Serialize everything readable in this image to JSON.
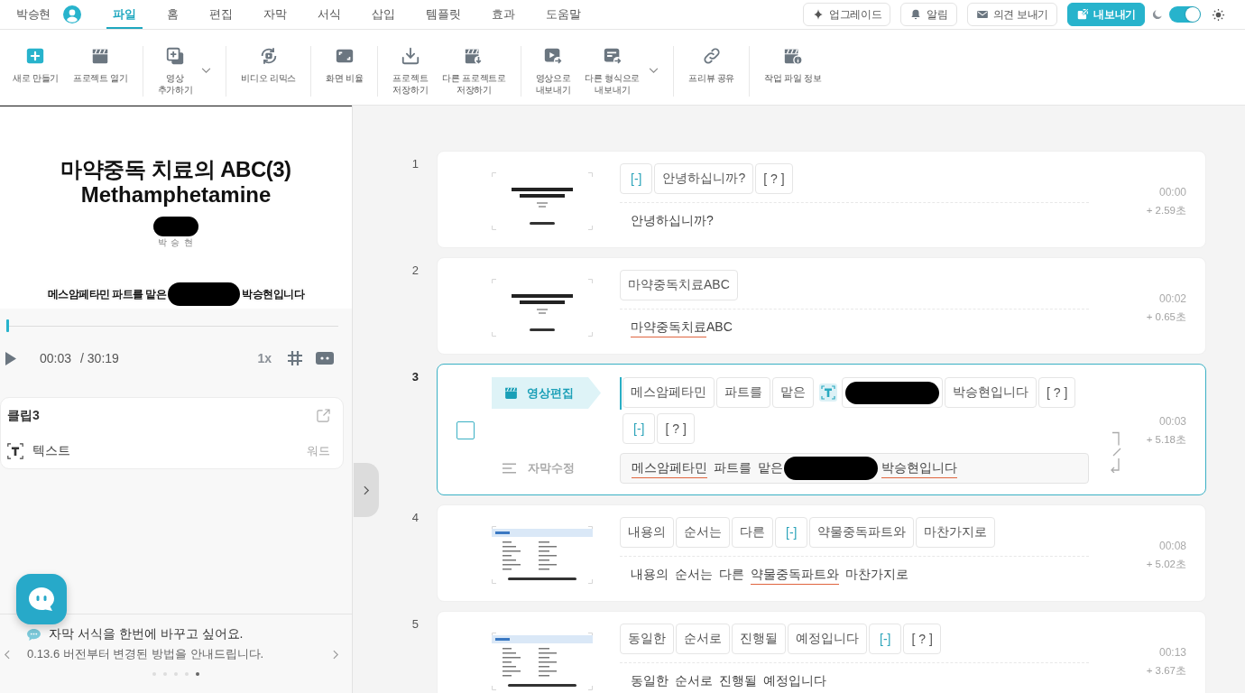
{
  "header": {
    "user": "박승현",
    "tabs": [
      {
        "label": "파일",
        "selected": true
      },
      {
        "label": "홈",
        "selected": false
      },
      {
        "label": "편집",
        "selected": false
      },
      {
        "label": "자막",
        "selected": false
      },
      {
        "label": "서식",
        "selected": false
      },
      {
        "label": "삽입",
        "selected": false
      },
      {
        "label": "템플릿",
        "selected": false
      },
      {
        "label": "효과",
        "selected": false
      },
      {
        "label": "도움말",
        "selected": false
      }
    ],
    "actions": [
      {
        "label": "업그레이드",
        "kind": "outline"
      },
      {
        "label": "알림",
        "kind": "outline"
      },
      {
        "label": "의견 보내기",
        "kind": "outline"
      },
      {
        "label": "내보내기",
        "kind": "primary"
      }
    ],
    "theme_toggle": {
      "on": true
    }
  },
  "toolbar": {
    "groups": [
      [
        {
          "label": "새로 만들기",
          "dropdown": false
        },
        {
          "label": "프로젝트 열기",
          "dropdown": false
        }
      ],
      [
        {
          "label": "영상\n추가하기",
          "dropdown": true
        }
      ],
      [
        {
          "label": "비디오 리믹스",
          "dropdown": false
        }
      ],
      [
        {
          "label": "화면 비율",
          "dropdown": false
        }
      ],
      [
        {
          "label": "프로젝트\n저장하기",
          "dropdown": false
        },
        {
          "label": "다른 프로젝트로\n저장하기",
          "dropdown": false
        }
      ],
      [
        {
          "label": "영상으로\n내보내기",
          "dropdown": false
        },
        {
          "label": "다른 형식으로\n내보내기",
          "dropdown": true
        }
      ],
      [
        {
          "label": "프리뷰 공유",
          "dropdown": false
        }
      ],
      [
        {
          "label": "작업 파일 정보",
          "dropdown": false
        }
      ]
    ]
  },
  "preview": {
    "lines": [
      {
        "kind": "title",
        "text": "마약중독 치료의 ABC(3)"
      },
      {
        "kind": "subtitle",
        "text": "Methamphetamine"
      },
      {
        "kind": "redacted"
      },
      {
        "kind": "presenter",
        "text": "박 승 현"
      }
    ],
    "caption": [
      {
        "kind": "text",
        "text": "메스암페타민 파트를 맡은"
      },
      {
        "kind": "redacted"
      },
      {
        "kind": "text",
        "text": "박승현입니다"
      }
    ]
  },
  "player": {
    "level": 0.002,
    "current": "00:03",
    "total": "/ 30:19",
    "speed": "1x"
  },
  "clip": {
    "title": "클립3",
    "type": "텍스트",
    "detail": "워드"
  },
  "tip": {
    "title": "자막 서식을 한번에 바꾸고 싶어요.",
    "body": "0.13.6 버전부터 변경된 방법을 안내드립니다.",
    "pages": [
      {
        "selected": false
      },
      {
        "selected": false
      },
      {
        "selected": false
      },
      {
        "selected": false
      },
      {
        "selected": true
      }
    ]
  },
  "rows": [
    {
      "number": "1",
      "selected": false,
      "thumbnail": {
        "kind": "title"
      },
      "chips": [
        {
          "kind": "gap",
          "text": "[-]"
        },
        {
          "kind": "word",
          "text": "안녕하십니까?"
        },
        {
          "kind": "unknown",
          "text": "[ ? ]"
        }
      ],
      "subtitle": [
        {
          "kind": "text",
          "text": "안녕하십니까?",
          "flagged": false
        }
      ],
      "time": "00:00",
      "duration": "+ 2.59초"
    },
    {
      "number": "2",
      "selected": false,
      "thumbnail": {
        "kind": "title"
      },
      "chips": [
        {
          "kind": "word",
          "text": "마약중독치료ABC"
        }
      ],
      "subtitle": [
        {
          "kind": "text",
          "text": "마약중독치료",
          "flagged": true
        },
        {
          "kind": "text",
          "text": "ABC",
          "flagged": false
        }
      ],
      "time": "00:02",
      "duration": "+ 0.65초"
    },
    {
      "number": "3",
      "selected": true,
      "editor": {
        "video_label": "영상편집",
        "subtitle_label": "자막수정",
        "checked": false
      },
      "chips": [
        {
          "kind": "word",
          "text": "메스암페타민"
        },
        {
          "kind": "word",
          "text": "파트를"
        },
        {
          "kind": "word",
          "text": "맡은"
        },
        {
          "kind": "text-clip"
        },
        {
          "kind": "redacted"
        },
        {
          "kind": "word",
          "text": "박승현입니다"
        },
        {
          "kind": "unknown",
          "text": "[ ? ]"
        },
        {
          "kind": "gap",
          "text": "[-]"
        },
        {
          "kind": "unknown",
          "text": "[ ? ]"
        }
      ],
      "subtitle": [
        {
          "kind": "text",
          "text": "메스암페타민",
          "flagged": true
        },
        {
          "kind": "text",
          "text": " 파트를 맡은",
          "flagged": false
        },
        {
          "kind": "redacted"
        },
        {
          "kind": "text",
          "text": "박승현입니다",
          "flagged": true
        }
      ],
      "time": "00:03",
      "duration": "+ 5.18초"
    },
    {
      "number": "4",
      "selected": false,
      "thumbnail": {
        "kind": "contents"
      },
      "chips": [
        {
          "kind": "word",
          "text": "내용의"
        },
        {
          "kind": "word",
          "text": "순서는"
        },
        {
          "kind": "word",
          "text": "다른"
        },
        {
          "kind": "gap",
          "text": "[-]"
        },
        {
          "kind": "word",
          "text": "약물중독파트와"
        },
        {
          "kind": "word",
          "text": "마찬가지로"
        }
      ],
      "subtitle": [
        {
          "kind": "text",
          "text": "내용의 순서는 다른 ",
          "flagged": false
        },
        {
          "kind": "text",
          "text": "약물중독파트와",
          "flagged": true
        },
        {
          "kind": "text",
          "text": " 마찬가지로",
          "flagged": false
        }
      ],
      "time": "00:08",
      "duration": "+ 5.02초"
    },
    {
      "number": "5",
      "selected": false,
      "thumbnail": {
        "kind": "contents"
      },
      "chips": [
        {
          "kind": "word",
          "text": "동일한"
        },
        {
          "kind": "word",
          "text": "순서로"
        },
        {
          "kind": "word",
          "text": "진행될"
        },
        {
          "kind": "word",
          "text": "예정입니다"
        },
        {
          "kind": "gap",
          "text": "[-]"
        },
        {
          "kind": "unknown",
          "text": "[ ? ]"
        }
      ],
      "subtitle": [
        {
          "kind": "text",
          "text": "동일한 순서로 진행될 예정입니다",
          "flagged": false
        }
      ],
      "time": "00:13",
      "duration": "+ 3.67초"
    }
  ]
}
